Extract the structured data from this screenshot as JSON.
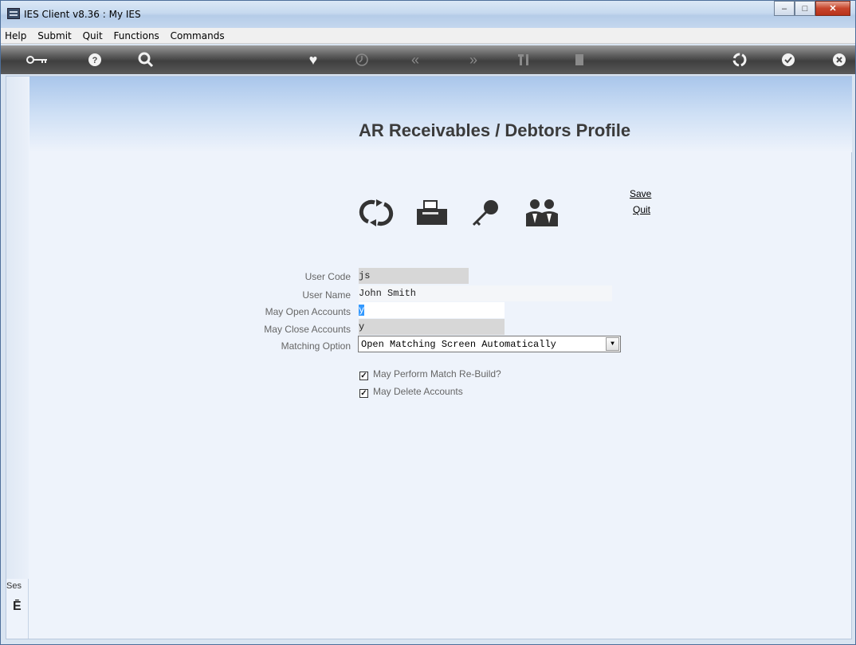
{
  "window": {
    "title": "IES Client v8.36 : My IES"
  },
  "menu": {
    "items": [
      "Help",
      "Submit",
      "Quit",
      "Functions",
      "Commands"
    ]
  },
  "toolbar": {
    "icons": [
      "key-icon",
      "help-icon",
      "search-icon",
      "favorite-icon",
      "clock-icon",
      "back-icon",
      "forward-icon",
      "tools-icon",
      "document-icon",
      "recycle-icon",
      "ok-icon",
      "close-icon"
    ]
  },
  "page": {
    "title": "AR Receivables / Debtors Profile",
    "actions": {
      "save": "Save",
      "quit": "Quit"
    },
    "side_label": "Ses"
  },
  "form": {
    "user_code": {
      "label": "User Code",
      "value": "js"
    },
    "user_name": {
      "label": "User Name",
      "value": "John Smith"
    },
    "may_open": {
      "label": "May Open Accounts",
      "value": "y"
    },
    "may_close": {
      "label": "May Close Accounts",
      "value": "y"
    },
    "matching": {
      "label": "Matching Option",
      "value": "Open Matching Screen Automatically"
    },
    "check_rebuild": {
      "label": "May Perform Match Re-Build?",
      "checked": true
    },
    "check_delete": {
      "label": "May Delete Accounts",
      "checked": true
    }
  },
  "colors": {
    "accent": "#a9c6eb",
    "toolbar": "#4a4a4a",
    "selection": "#3399ff"
  }
}
